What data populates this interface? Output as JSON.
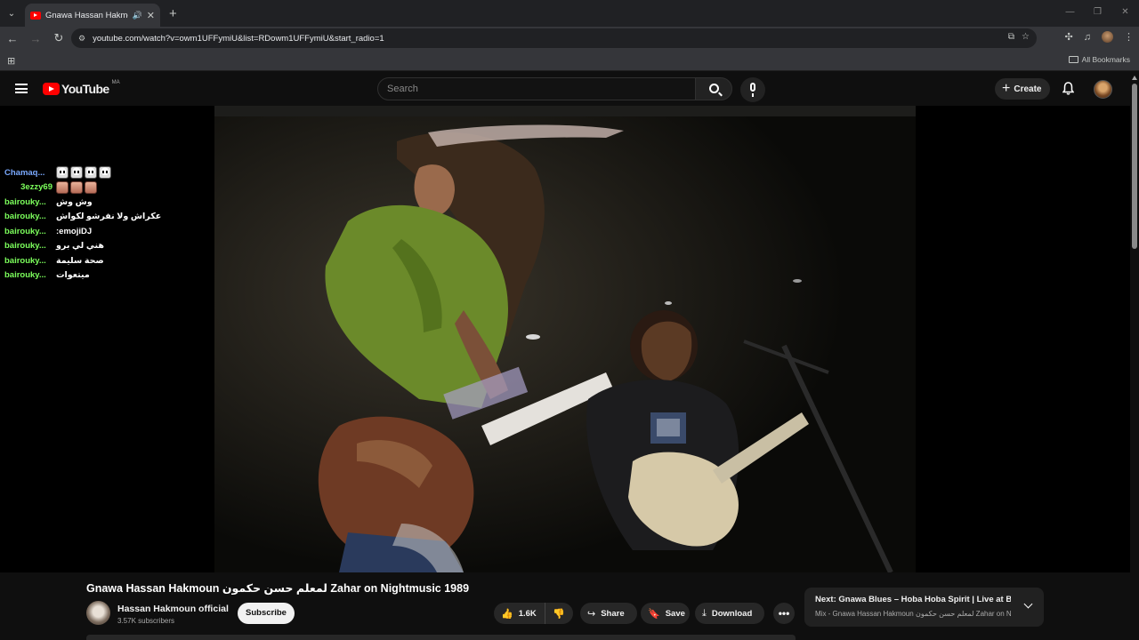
{
  "browser": {
    "tab_title": "Gnawa Hassan Hakmoun",
    "url": "youtube.com/watch?v=owm1UFFymiU&list=RDowm1UFFymiU&start_radio=1",
    "bookmarks_label": "All Bookmarks"
  },
  "yt": {
    "logo_text": "YouTube",
    "country_code": "MA",
    "search_placeholder": "Search",
    "create_label": "Create"
  },
  "chat": [
    {
      "user": "Chamaq...",
      "message": "",
      "emotes": [
        "skull",
        "skull",
        "skull",
        "skull"
      ],
      "color": "#7aa9ff"
    },
    {
      "user": "3ezzy69",
      "message": "",
      "emotes": [
        "face",
        "face",
        "face"
      ],
      "color": "#7cff5c"
    },
    {
      "user": "bairouky...",
      "message": "وش وش",
      "emotes": [],
      "color": "#7cff5c"
    },
    {
      "user": "bairouky...",
      "message": "عكراش ولا نفرشو لكواش",
      "emotes": [],
      "color": "#7cff5c"
    },
    {
      "user": "bairouky...",
      "message": ":emojiDJ",
      "emotes": [],
      "color": "#7cff5c"
    },
    {
      "user": "bairouky...",
      "message": "هني لي برو",
      "emotes": [],
      "color": "#7cff5c"
    },
    {
      "user": "bairouky...",
      "message": "صحة سليمة",
      "emotes": [],
      "color": "#7cff5c"
    },
    {
      "user": "bairouky...",
      "message": "ميتعوات",
      "emotes": [],
      "color": "#7cff5c"
    }
  ],
  "video": {
    "title": "Gnawa Hassan Hakmoun لمعلم حسن حكمون Zahar on Nightmusic 1989",
    "channel": "Hassan Hakmoun official",
    "subscribers": "3.57K subscribers",
    "subscribe_label": "Subscribe",
    "likes": "1.6K",
    "share_label": "Share",
    "save_label": "Save",
    "download_label": "Download"
  },
  "next": {
    "title": "Next: Gnawa Blues – Hoba Hoba Spirit | Live at Blu...",
    "subtitle": "Mix - Gnawa Hassan Hakmoun لمعلم حسن حكمون Zahar on Night..."
  }
}
